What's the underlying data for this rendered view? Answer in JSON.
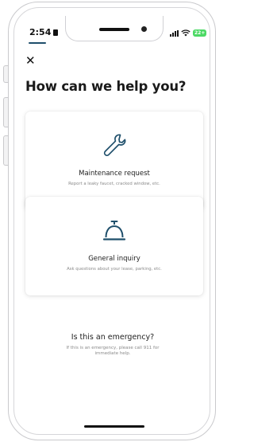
{
  "status_bar": {
    "time": "2:54",
    "battery": "22+",
    "icons": [
      "cellular-signal-icon",
      "wifi-icon",
      "battery-icon"
    ]
  },
  "header": {
    "close_label": "✕",
    "title": "How can we help you?"
  },
  "options": [
    {
      "icon": "wrench-icon",
      "title": "Maintenance request",
      "subtitle": "Report a leaky faucet, cracked window, etc."
    },
    {
      "icon": "service-bell-icon",
      "title": "General inquiry",
      "subtitle": "Ask questions about your lease, parking, etc."
    }
  ],
  "emergency": {
    "title": "Is this an emergency?",
    "text": "If this is an emergency, please call 911 for immediate help."
  },
  "colors": {
    "accent": "#1f4f6b",
    "icon": "#1f4f6b",
    "battery": "#4cd964"
  }
}
